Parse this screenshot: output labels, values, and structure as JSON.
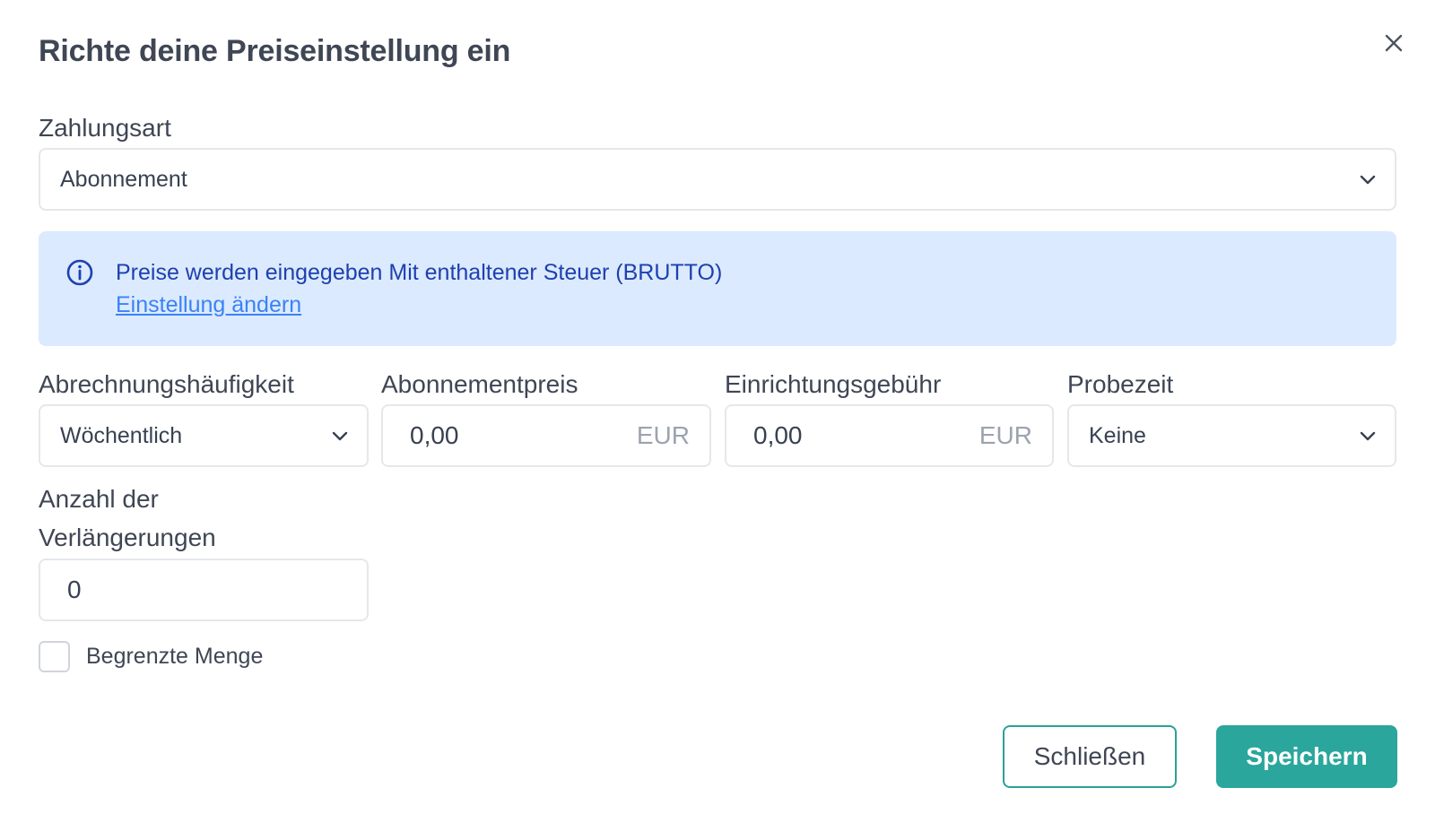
{
  "dialog": {
    "title": "Richte deine Preiseinstellung ein",
    "close_icon": "close-icon"
  },
  "payment_type": {
    "label": "Zahlungsart",
    "value": "Abonnement"
  },
  "info": {
    "text": "Preise werden eingegeben Mit enthaltener Steuer (BRUTTO)",
    "link": "Einstellung ändern",
    "icon": "info-icon"
  },
  "billing_frequency": {
    "label": "Abrechnungshäufigkeit",
    "value": "Wöchentlich"
  },
  "subscription_price": {
    "label": "Abonnementpreis",
    "value": "0,00",
    "currency": "EUR"
  },
  "setup_fee": {
    "label": "Einrichtungsgebühr",
    "value": "0,00",
    "currency": "EUR"
  },
  "trial": {
    "label": "Probezeit",
    "value": "Keine"
  },
  "renewals": {
    "label_line1": "Anzahl der",
    "label_line2": "Verlängerungen",
    "value": "0"
  },
  "limited_quantity": {
    "label": "Begrenzte Menge",
    "checked": false
  },
  "footer": {
    "close_label": "Schließen",
    "save_label": "Speichern"
  },
  "colors": {
    "accent": "#2aa69c",
    "info_bg": "#dbeafe",
    "info_text": "#1e40af",
    "link": "#3b82f6"
  }
}
